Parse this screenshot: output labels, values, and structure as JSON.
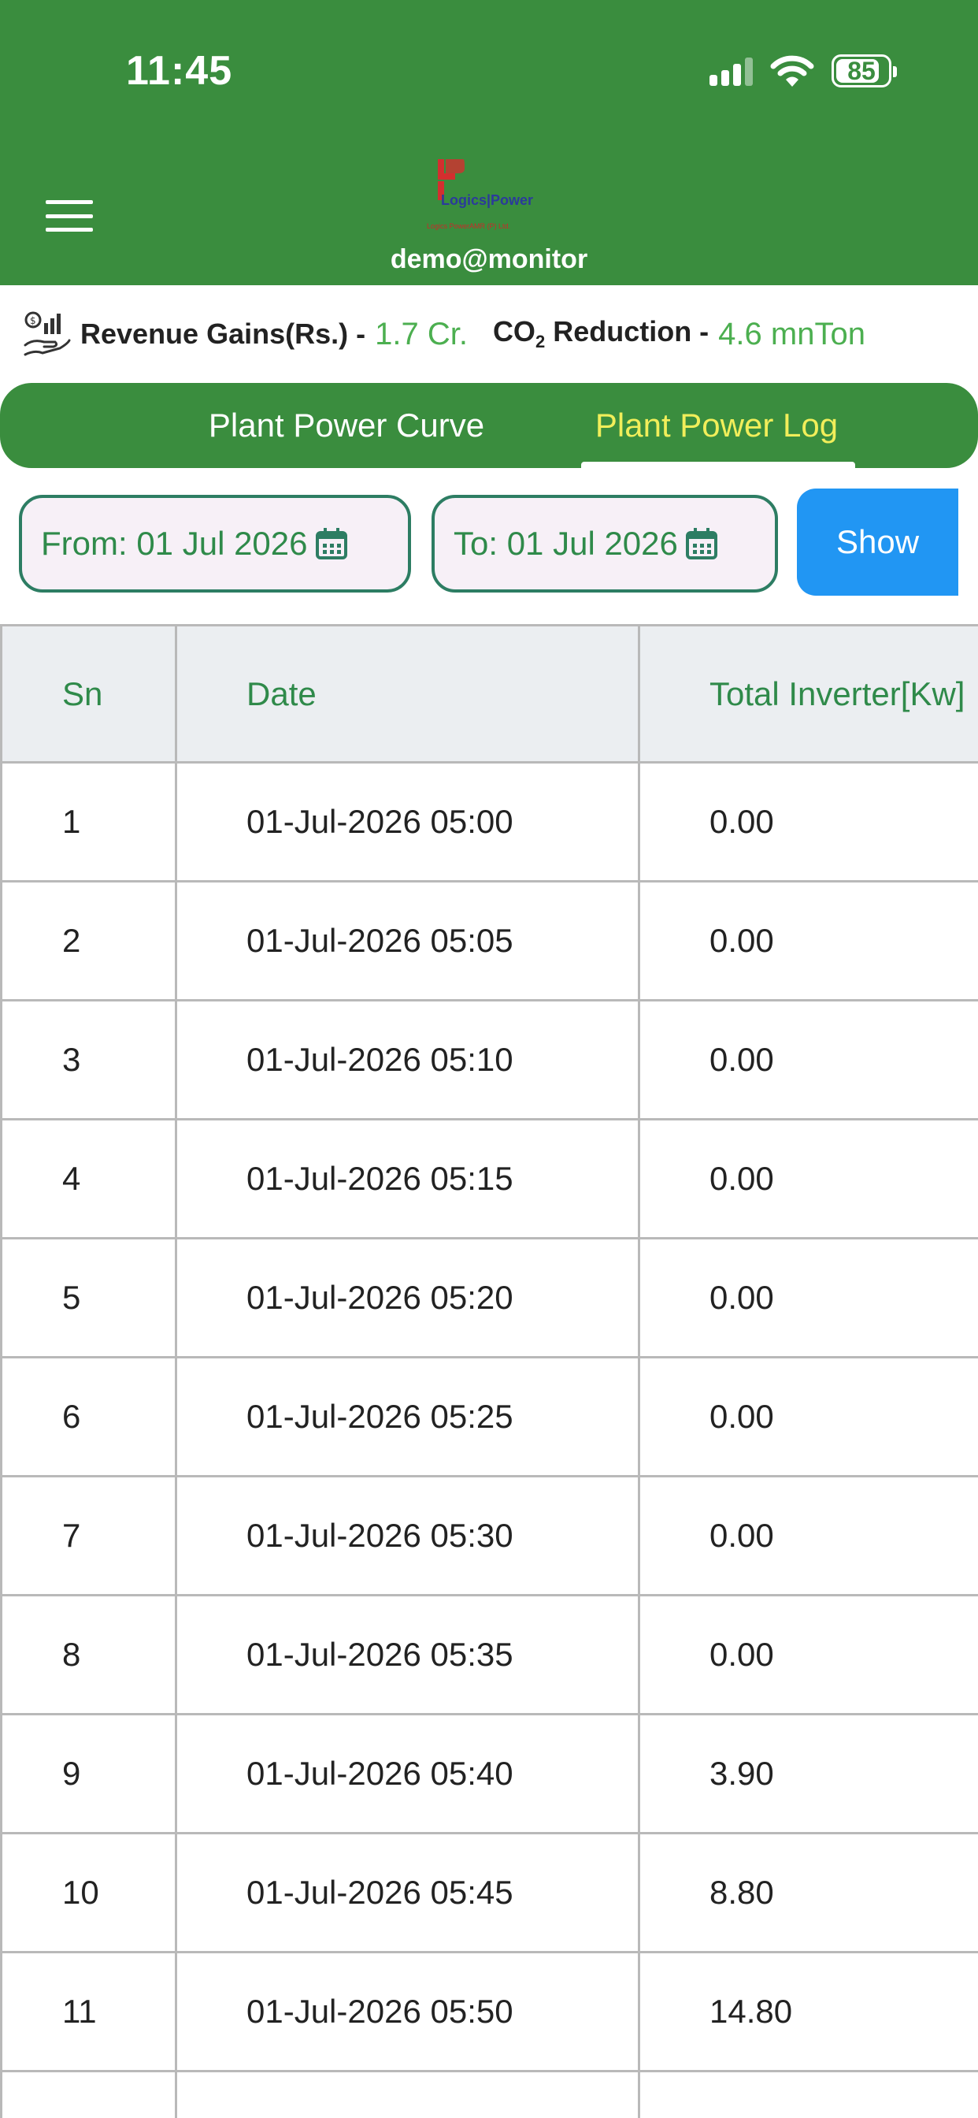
{
  "status_bar": {
    "time": "11:45",
    "battery": "85",
    "battery_level": 0.85,
    "icons": [
      "signal-icon",
      "wifi-icon",
      "battery-icon"
    ]
  },
  "header": {
    "menu_icon": "hamburger-menu-icon",
    "logo_text": "Logics|Power",
    "logo_subtitle": "Logics PowerAMR (P) Ltd.",
    "user": "demo@monitor",
    "color": "#3a8d3e"
  },
  "stats": {
    "icon": "revenue-hand-icon",
    "revenue_label": "Revenue Gains(Rs.) -",
    "revenue_value": "1.7 Cr.",
    "co2_prefix": "CO",
    "co2_sub": "2",
    "co2_label": " Reduction -",
    "co2_value": "4.6 mnTon",
    "value_color": "#4caf50"
  },
  "tabs": [
    {
      "label": "Plant Power Curve",
      "active": false
    },
    {
      "label": "Plant Power Log",
      "active": true
    }
  ],
  "filters": {
    "from_label": "From: 01 Jul 2026",
    "to_label": "To: 01 Jul 2026",
    "show_label": "Show",
    "calendar_icon": "calendar-icon",
    "show_color": "#2196f3"
  },
  "table": {
    "columns": [
      "Sn",
      "Date",
      "Total Inverter[Kw]"
    ],
    "rows": [
      [
        "1",
        "01-Jul-2026 05:00",
        "0.00"
      ],
      [
        "2",
        "01-Jul-2026 05:05",
        "0.00"
      ],
      [
        "3",
        "01-Jul-2026 05:10",
        "0.00"
      ],
      [
        "4",
        "01-Jul-2026 05:15",
        "0.00"
      ],
      [
        "5",
        "01-Jul-2026 05:20",
        "0.00"
      ],
      [
        "6",
        "01-Jul-2026 05:25",
        "0.00"
      ],
      [
        "7",
        "01-Jul-2026 05:30",
        "0.00"
      ],
      [
        "8",
        "01-Jul-2026 05:35",
        "0.00"
      ],
      [
        "9",
        "01-Jul-2026 05:40",
        "3.90"
      ],
      [
        "10",
        "01-Jul-2026 05:45",
        "8.80"
      ],
      [
        "11",
        "01-Jul-2026 05:50",
        "14.80"
      ],
      [
        "",
        "",
        ""
      ]
    ]
  }
}
